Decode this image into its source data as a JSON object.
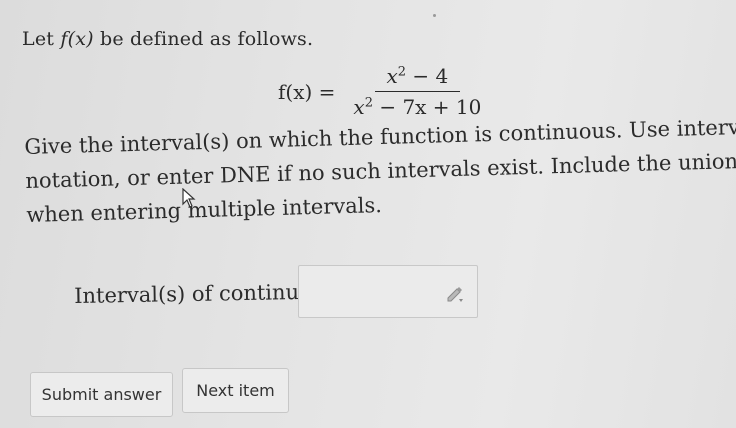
{
  "problem": {
    "intro_prefix": "Let ",
    "intro_func": "f(x)",
    "intro_suffix": " be defined as follows.",
    "formula": {
      "lhs": "f(x) =",
      "numerator_base": "x",
      "numerator_exp": "2",
      "numerator_rest": " − 4",
      "denominator_base": "x",
      "denominator_exp": "2",
      "denominator_rest": " − 7x + 10"
    },
    "instructions_lines": [
      "Give the interval(s) on which the function is continuous. Use interval",
      "notation, or enter DNE if no such intervals exist. Include the union symbol",
      "when entering multiple intervals."
    ]
  },
  "answer": {
    "label": "Interval(s) of continuity:",
    "value": "",
    "icon": "pencil-icon"
  },
  "buttons": {
    "submit_label": "Submit answer",
    "next_label": "Next item"
  }
}
